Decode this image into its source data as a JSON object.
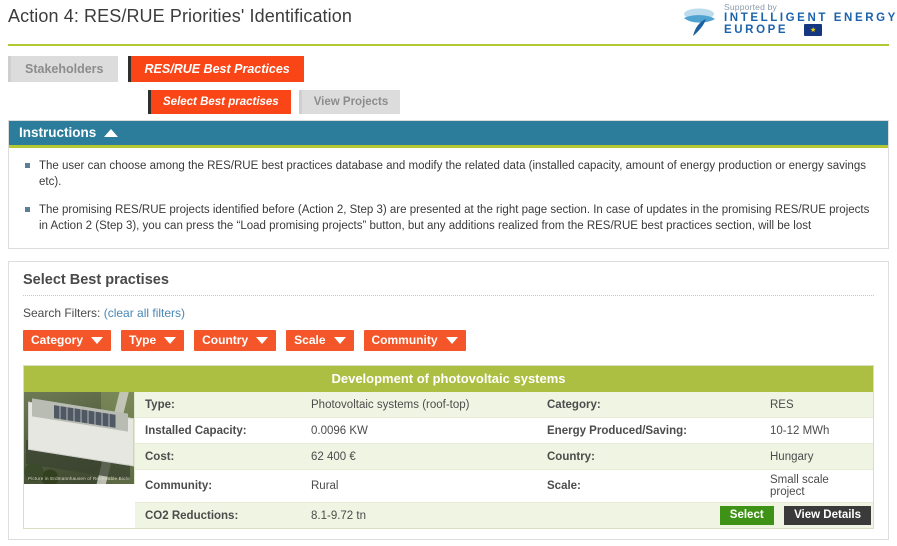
{
  "header": {
    "title": "Action 4: RES/RUE Priorities' Identification",
    "logo": {
      "supported_by": "Supported by",
      "line1": "INTELLIGENT ENERGY",
      "line2": "EUROPE",
      "flag_star": "★"
    }
  },
  "tabs": {
    "level1": [
      {
        "label": "Stakeholders",
        "active": false
      },
      {
        "label": "RES/RUE Best Practices",
        "active": true
      }
    ],
    "level2": [
      {
        "label": "Select Best practises",
        "active": true
      },
      {
        "label": "View Projects",
        "active": false
      }
    ]
  },
  "instructions": {
    "title": "Instructions",
    "collapse_icon": "caret-up-icon",
    "items": [
      "The user can choose among the RES/RUE best practices database and modify the related data (installed capacity, amount of energy production or energy savings etc).",
      "The promising RES/RUE projects identified before (Action 2, Step 3) are presented at the right page section. In case of updates in the promising RES/RUE projects in Action 2 (Step 3), you can press the “Load promising projects” button, but any additions realized from the RES/RUE best practices section, will be lost"
    ]
  },
  "select_best_practises": {
    "title": "Select Best practises",
    "search_filters_label": "Search Filters:",
    "clear_all_filters": "(clear all filters)",
    "filters": [
      {
        "label": "Category"
      },
      {
        "label": "Type"
      },
      {
        "label": "Country"
      },
      {
        "label": "Scale"
      },
      {
        "label": "Community"
      }
    ]
  },
  "result_card": {
    "title": "Development of photovoltaic systems",
    "thumbnail_caption": "Picture in Erdmannhausen of Renewable Biological, www",
    "rows": [
      {
        "label_left": "Type:",
        "value_left": "Photovoltaic systems (roof-top)",
        "label_right": "Category:",
        "value_right": "RES"
      },
      {
        "label_left": "Installed Capacity:",
        "value_left": "0.0096 KW",
        "label_right": "Energy Produced/Saving:",
        "value_right": "10-12 MWh"
      },
      {
        "label_left": "Cost:",
        "value_left": "62 400 €",
        "label_right": "Country:",
        "value_right": "Hungary"
      },
      {
        "label_left": "Community:",
        "value_left": "Rural",
        "label_right": "Scale:",
        "value_right": "Small scale project"
      }
    ],
    "last_row": {
      "label": "CO2 Reductions:",
      "value": "8.1-9.72 tn"
    },
    "select_button": "Select",
    "view_details_button": "View Details"
  },
  "colors": {
    "accent_orange": "#fa4616",
    "filter_orange": "#f4562a",
    "green_rule": "#b3c832",
    "card_green": "#acbf43",
    "teal": "#2b7d9b",
    "select_green": "#3e9216",
    "details_dark": "#3a3a3a",
    "link_blue": "#4a87b5"
  }
}
